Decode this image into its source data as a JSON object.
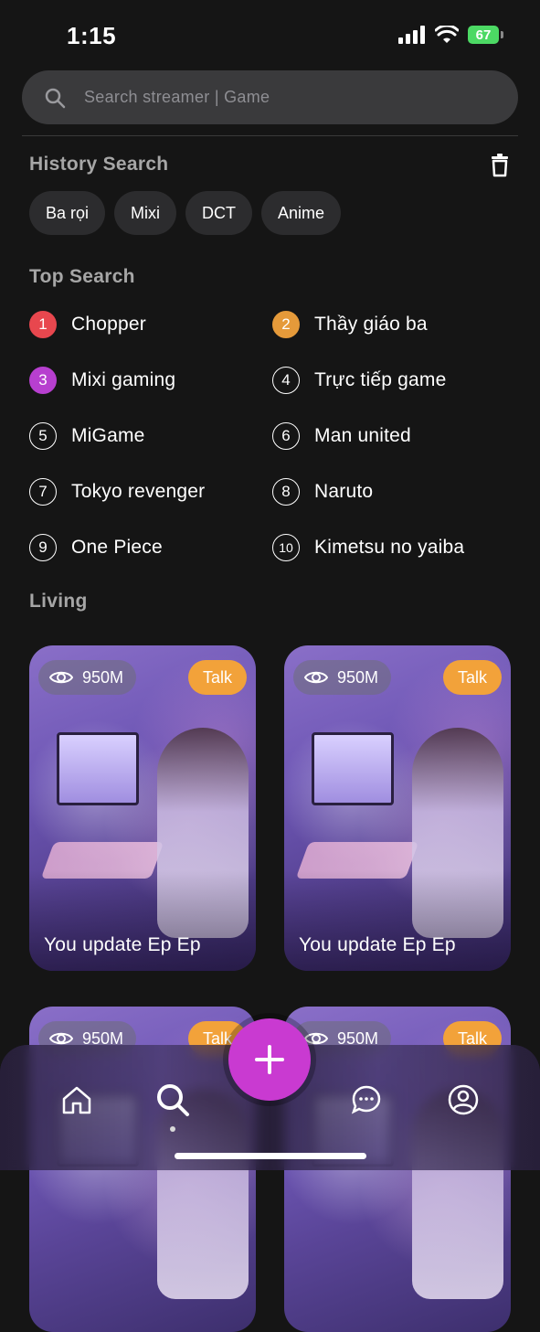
{
  "status_bar": {
    "time": "1:15",
    "battery": "67"
  },
  "search": {
    "placeholder": "Search streamer | Game",
    "icon": "search-icon"
  },
  "history": {
    "title": "History Search",
    "clear_icon": "trash-icon",
    "chips": [
      "Ba rọi",
      "Mixi",
      "DCT",
      "Anime"
    ]
  },
  "top_search": {
    "title": "Top Search",
    "items": [
      {
        "rank": "1",
        "label": "Chopper"
      },
      {
        "rank": "2",
        "label": "Thầy giáo ba"
      },
      {
        "rank": "3",
        "label": "Mixi gaming"
      },
      {
        "rank": "4",
        "label": "Trực tiếp game"
      },
      {
        "rank": "5",
        "label": "MiGame"
      },
      {
        "rank": "6",
        "label": "Man united"
      },
      {
        "rank": "7",
        "label": "Tokyo revenger"
      },
      {
        "rank": "8",
        "label": "Naruto"
      },
      {
        "rank": "9",
        "label": "One Piece"
      },
      {
        "rank": "10",
        "label": "Kimetsu no yaiba"
      }
    ],
    "rank_colors": {
      "1": "#e8474e",
      "2": "#e59a3a",
      "3": "#b73fcf"
    }
  },
  "living": {
    "title": "Living",
    "cards": [
      {
        "views": "950M",
        "tag": "Talk",
        "title": "You update Ep Ep"
      },
      {
        "views": "950M",
        "tag": "Talk",
        "title": "You update Ep Ep"
      },
      {
        "views": "950M",
        "tag": "Talk",
        "title": ""
      },
      {
        "views": "950M",
        "tag": "Talk",
        "title": ""
      }
    ]
  },
  "tab_bar": {
    "tabs": [
      "home-icon",
      "search-icon",
      "add-icon",
      "chat-icon",
      "profile-icon"
    ],
    "active": "search-icon"
  },
  "colors": {
    "accent": "#c93ad1",
    "tag": "#f2a23a",
    "background": "#151515"
  }
}
